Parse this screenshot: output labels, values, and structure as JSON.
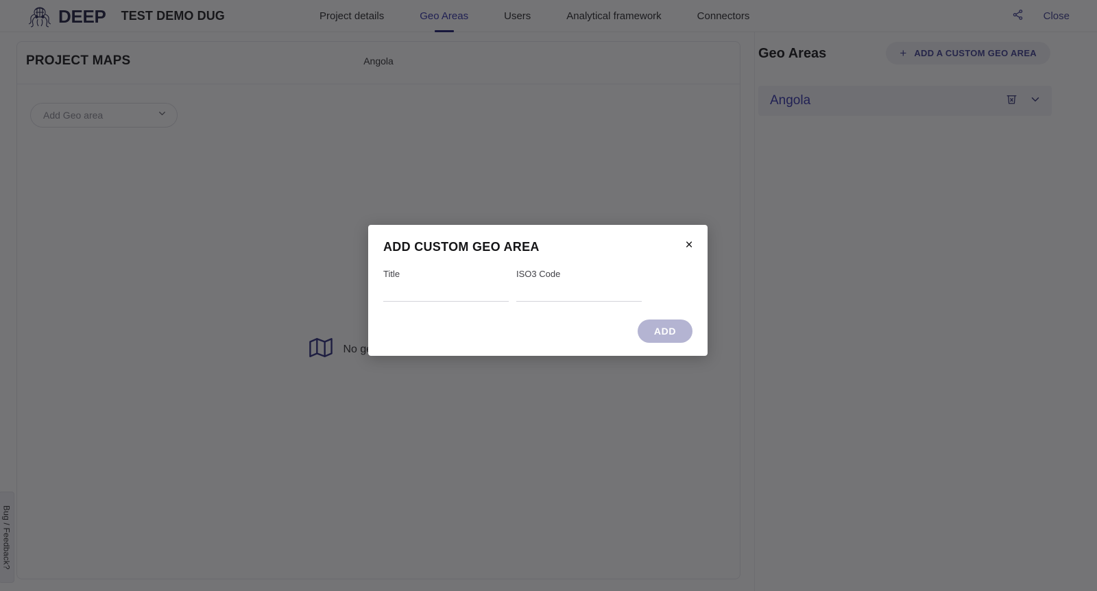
{
  "header": {
    "logo_text": "DEEP",
    "logo_icon": "deep-octopus-brain-logo",
    "project_title": "TEST DEMO DUG",
    "nav_tabs": [
      {
        "label": "Project details",
        "active": false
      },
      {
        "label": "Geo Areas",
        "active": true
      },
      {
        "label": "Users",
        "active": false
      },
      {
        "label": "Analytical framework",
        "active": false
      },
      {
        "label": "Connectors",
        "active": false
      }
    ],
    "share_icon": "share-icon",
    "close_label": "Close"
  },
  "project_maps": {
    "title": "PROJECT MAPS",
    "map_country_label": "Angola",
    "geo_select": {
      "placeholder": "Add Geo area",
      "chevron_icon": "chevron-down-icon"
    },
    "empty_state": {
      "icon": "map-icon",
      "text": "No geo area selected"
    }
  },
  "geo_panel": {
    "title": "Geo Areas",
    "add_button": {
      "label": "ADD A CUSTOM GEO AREA",
      "plus_icon": "plus-icon",
      "plus_glyph": "+"
    },
    "items": [
      {
        "label": "Angola",
        "delete_icon": "delete-bin-icon",
        "expand_icon": "chevron-down-icon"
      }
    ]
  },
  "feedback_tab": {
    "label": "Bug / Feedback?"
  },
  "modal": {
    "title": "ADD CUSTOM GEO AREA",
    "close_icon": "close-icon",
    "close_glyph": "×",
    "fields": [
      {
        "label": "Title",
        "value": "",
        "placeholder": ""
      },
      {
        "label": "ISO3 Code",
        "value": "",
        "placeholder": ""
      }
    ],
    "submit_label": "ADD"
  },
  "colors": {
    "accent_blue": "#2e2ea8",
    "link_blue": "#3b3b8f",
    "disabled_button": "#b4b4d2",
    "overlay": "rgba(23,23,26,0.60)"
  }
}
